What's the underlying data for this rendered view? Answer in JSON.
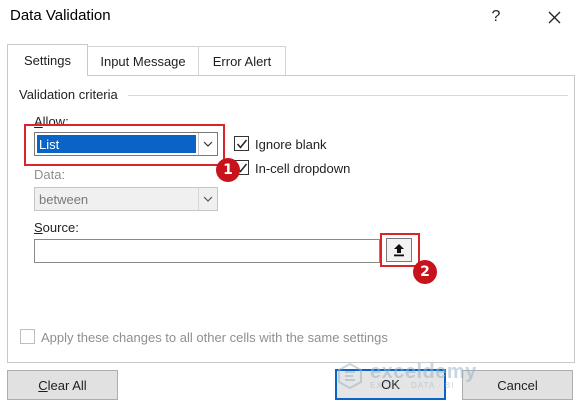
{
  "window": {
    "title": "Data Validation",
    "help_label": "?",
    "close_label": "✕"
  },
  "tabs": [
    {
      "label": "Settings",
      "active": true
    },
    {
      "label": "Input Message",
      "active": false
    },
    {
      "label": "Error Alert",
      "active": false
    }
  ],
  "criteria": {
    "group_label": "Validation criteria",
    "allow_label": "Allow:",
    "allow_value": "List",
    "ignore_blank_label": "Ignore blank",
    "ignore_blank_checked": true,
    "in_cell_dropdown_label": "In-cell dropdown",
    "in_cell_dropdown_checked": true,
    "data_label": "Data:",
    "data_value": "between",
    "source_label": "Source:",
    "source_value": ""
  },
  "apply_all_label": "Apply these changes to all other cells with the same settings",
  "apply_all_checked": false,
  "annotations": {
    "badge1": "1",
    "badge2": "2"
  },
  "watermark": {
    "name": "exceldemy",
    "tagline": "EXCEL · DATA · BI"
  },
  "buttons": {
    "clear_all": "Clear All",
    "ok": "OK",
    "cancel": "Cancel"
  },
  "colors": {
    "highlight": "#d9242b",
    "badge": "#c8121c",
    "selection": "#0a64c8"
  }
}
